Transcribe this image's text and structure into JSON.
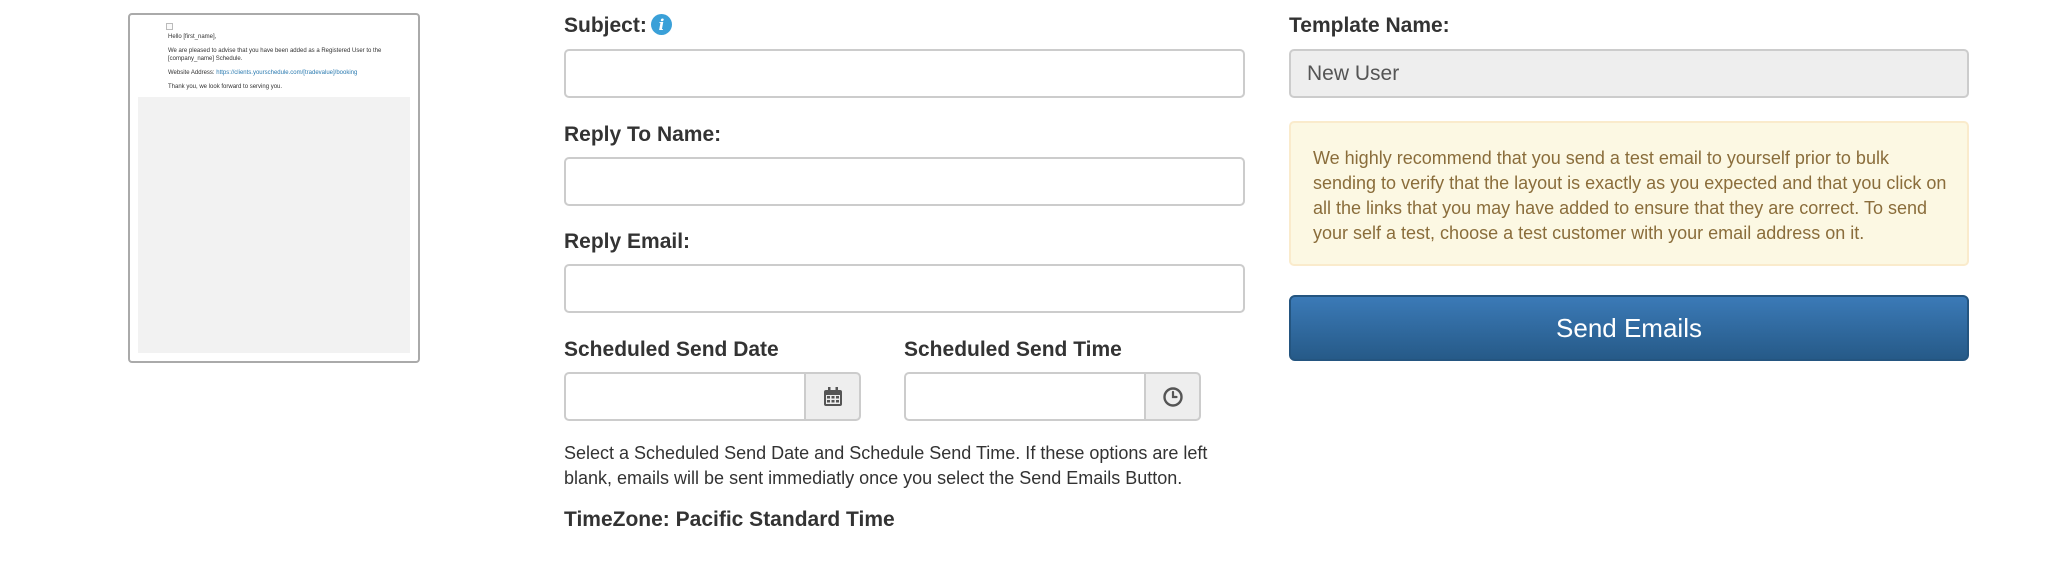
{
  "preview": {
    "greeting": "Hello [first_name],",
    "line1": "We are pleased to advise that you have been added as a Registered User to the [company_name] Schedule.",
    "website_label": "Website Address:",
    "website_link": "https://clients.yourschedule.com/[tradevalue]/booking",
    "closing": "Thank you, we look forward to serving you."
  },
  "form": {
    "subject_label": "Subject:",
    "subject_value": "",
    "reply_to_name_label": "Reply To Name:",
    "reply_to_name_value": "",
    "reply_email_label": "Reply Email:",
    "reply_email_value": "",
    "send_date_label": "Scheduled Send Date",
    "send_date_value": "",
    "send_time_label": "Scheduled Send Time",
    "send_time_value": "",
    "help_text": "Select a Scheduled Send Date and Schedule Send Time. If these options are left blank, emails will be sent immediatly once you select the Send Emails Button.",
    "timezone_label": "TimeZone:",
    "timezone_value": "Pacific Standard Time"
  },
  "template": {
    "name_label": "Template Name:",
    "name_value": "New User"
  },
  "alert": {
    "text": "We highly recommend that you send a test email to yourself prior to bulk sending to verify that the layout is exactly as you expected and that you click on all the links that you may have added to ensure that they are correct. To send your self a test, choose a test customer with your email address on it."
  },
  "actions": {
    "send_label": "Send Emails"
  },
  "colors": {
    "primary": "#337ab7",
    "info": "#31a0d8",
    "warning_bg": "#fcf8e3",
    "warning_text": "#8a6d3b"
  },
  "icons": {
    "info": "info-icon",
    "calendar": "calendar-icon",
    "clock": "clock-icon"
  }
}
